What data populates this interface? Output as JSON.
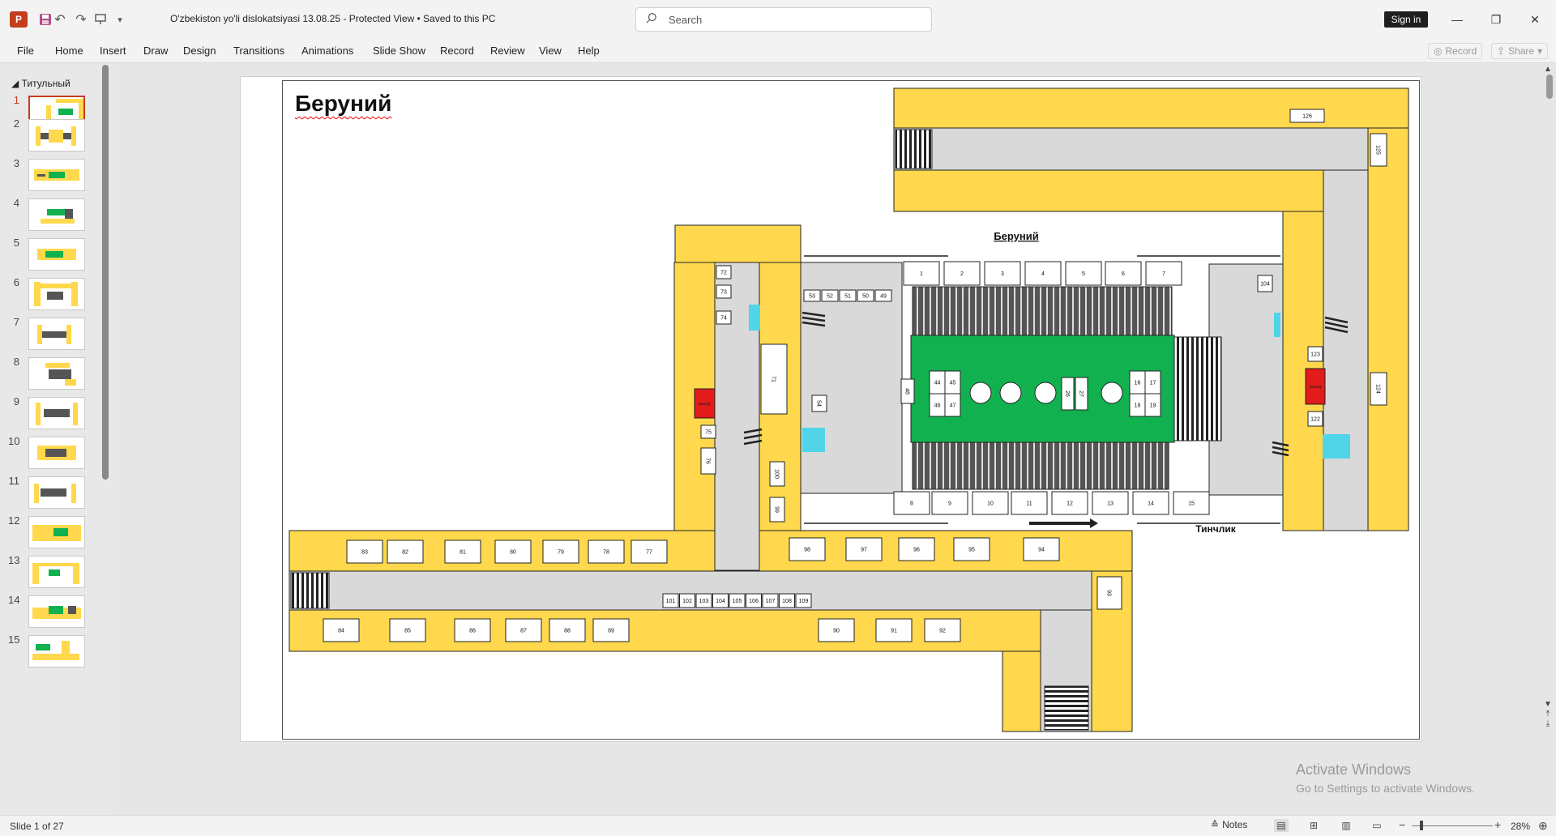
{
  "titlebar": {
    "doc_title": "O'zbekiston yo'li dislokatsiyasi 13.08.25  -  Protected View  •  Saved to this PC",
    "search_placeholder": "Search",
    "signin_label": "Sign in",
    "icons": [
      "powerpoint-logo",
      "save-icon",
      "undo-icon",
      "redo-icon",
      "present-icon",
      "customize-icon"
    ]
  },
  "ribbon": {
    "tabs": [
      "File",
      "Home",
      "Insert",
      "Draw",
      "Design",
      "Transitions",
      "Animations",
      "Slide Show",
      "Record",
      "Review",
      "View",
      "Help"
    ],
    "record_label": "Record",
    "share_label": "Share"
  },
  "thumbnails": {
    "section_label": "Титульный",
    "numbers": [
      "1",
      "2",
      "3",
      "4",
      "5",
      "6",
      "7",
      "8",
      "9",
      "10",
      "11",
      "12",
      "13",
      "14",
      "15"
    ],
    "active": "1"
  },
  "slide": {
    "title": "Беруний",
    "station_label": "Беруний",
    "street_label": "Тинчлик",
    "shops_top": [
      "1",
      "2",
      "3",
      "4",
      "5",
      "6",
      "7"
    ],
    "shops_bottom": [
      "8",
      "9",
      "10",
      "11",
      "12",
      "13",
      "14",
      "15"
    ],
    "shops_small_left": [
      "53",
      "52",
      "51",
      "50",
      "49"
    ],
    "shops_lower_hall_top": [
      "83",
      "82",
      "81",
      "80",
      "79",
      "78",
      "77"
    ],
    "shops_lower_hall_mid": [
      "98",
      "97",
      "96",
      "95",
      "94"
    ],
    "shops_lower_hall_bottom": [
      "84",
      "85",
      "86",
      "87",
      "88",
      "89",
      "90",
      "91",
      "92"
    ],
    "kiosks_row": [
      "101",
      "102",
      "103",
      "104",
      "105",
      "106",
      "107",
      "108",
      "109"
    ],
    "right_side": [
      "126",
      "125",
      "124",
      "104",
      "123",
      "122"
    ],
    "left_column": [
      "72",
      "73",
      "74",
      "71",
      "75",
      "76",
      "54",
      "100",
      "99",
      "48"
    ],
    "platform_kiosks": [
      "44",
      "45",
      "46",
      "47",
      "16",
      "17",
      "18",
      "19",
      "26",
      "27"
    ],
    "exit_labels": [
      "выход",
      "выход"
    ],
    "side_tag": "93"
  },
  "activate_windows": {
    "line1": "Activate Windows",
    "line2": "Go to Settings to activate Windows."
  },
  "statusbar": {
    "slide_counter": "Slide 1 of 27",
    "notes_label": "Notes",
    "zoom_level": "28%"
  }
}
